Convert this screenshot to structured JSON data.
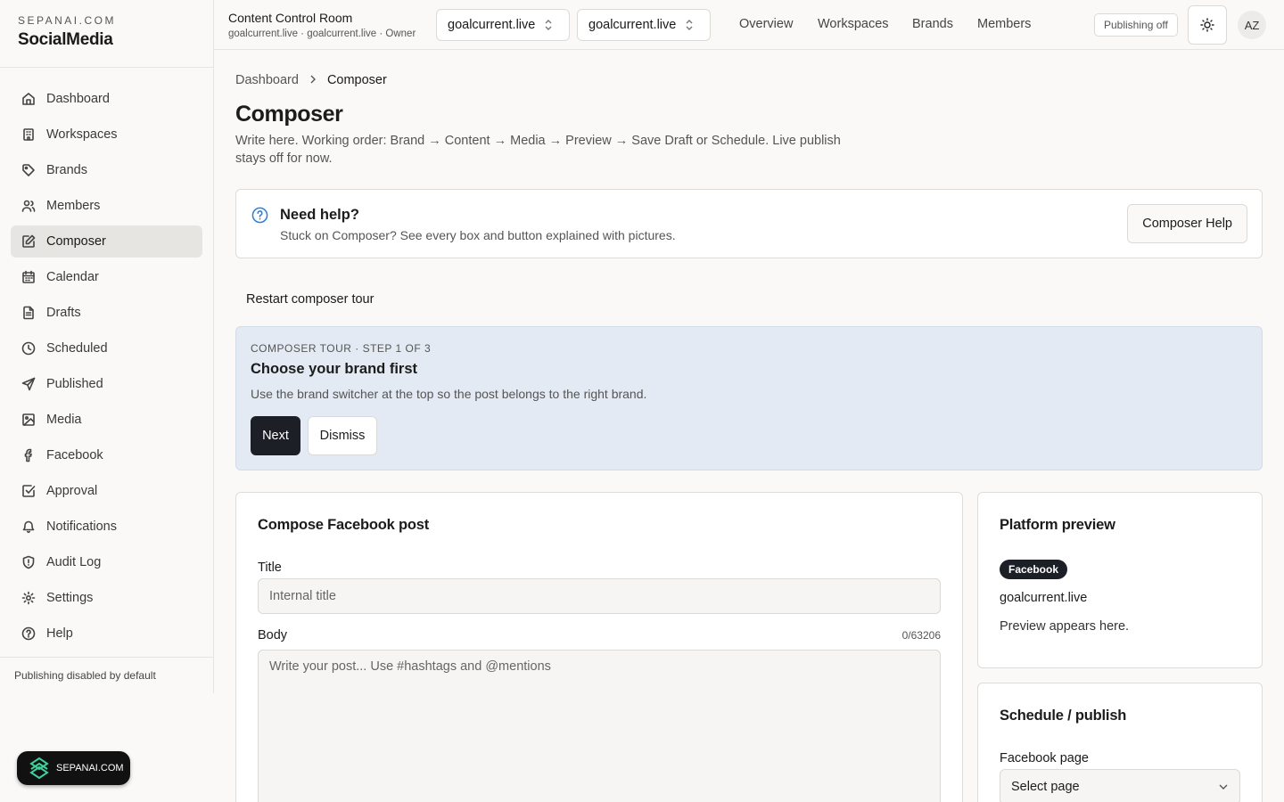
{
  "brand": {
    "kicker": "SEPANAI.COM",
    "name": "SocialMedia"
  },
  "sidebar": {
    "items": [
      {
        "label": "Dashboard",
        "icon": "home-icon"
      },
      {
        "label": "Workspaces",
        "icon": "building-icon"
      },
      {
        "label": "Brands",
        "icon": "tag-icon"
      },
      {
        "label": "Members",
        "icon": "users-icon"
      },
      {
        "label": "Composer",
        "icon": "edit-icon",
        "active": true
      },
      {
        "label": "Calendar",
        "icon": "calendar-icon"
      },
      {
        "label": "Drafts",
        "icon": "file-icon"
      },
      {
        "label": "Scheduled",
        "icon": "clock-icon"
      },
      {
        "label": "Published",
        "icon": "send-icon"
      },
      {
        "label": "Media",
        "icon": "image-icon"
      },
      {
        "label": "Facebook",
        "icon": "facebook-icon"
      },
      {
        "label": "Approval",
        "icon": "check-square-icon"
      },
      {
        "label": "Notifications",
        "icon": "bell-icon"
      },
      {
        "label": "Audit Log",
        "icon": "shield-icon"
      },
      {
        "label": "Settings",
        "icon": "gear-icon"
      },
      {
        "label": "Help",
        "icon": "help-circle-icon"
      }
    ],
    "footer": "Publishing disabled by default"
  },
  "badge": {
    "label": "SEPANAI.COM"
  },
  "topbar": {
    "room_title": "Content Control Room",
    "room_sub": "goalcurrent.live · goalcurrent.live · Owner",
    "workspace_select": "goalcurrent.live",
    "brand_select": "goalcurrent.live",
    "nav": [
      "Overview",
      "Workspaces",
      "Brands",
      "Members"
    ],
    "publishing_status": "Publishing off",
    "avatar_initials": "AZ"
  },
  "breadcrumb": {
    "parent": "Dashboard",
    "current": "Composer"
  },
  "page": {
    "title": "Composer",
    "description": "Write here. Working order: Brand → Content → Media → Preview → Save Draft or Schedule. Live publish stays off for now."
  },
  "help": {
    "title": "Need help?",
    "subtitle": "Stuck on Composer? See every box and button explained with pictures.",
    "button": "Composer Help"
  },
  "restart_tour": "Restart composer tour",
  "tour": {
    "kicker": "COMPOSER TOUR · STEP 1 OF 3",
    "title": "Choose your brand first",
    "text": "Use the brand switcher at the top so the post belongs to the right brand.",
    "next": "Next",
    "dismiss": "Dismiss"
  },
  "compose": {
    "title": "Compose Facebook post",
    "title_label": "Title",
    "title_placeholder": "Internal title",
    "body_label": "Body",
    "body_counter": "0/63206",
    "body_placeholder": "Write your post... Use #hashtags and @mentions"
  },
  "preview": {
    "title": "Platform preview",
    "platform": "Facebook",
    "brand": "goalcurrent.live",
    "text": "Preview appears here."
  },
  "schedule": {
    "title": "Schedule / publish",
    "page_label": "Facebook page",
    "page_select": "Select page"
  }
}
